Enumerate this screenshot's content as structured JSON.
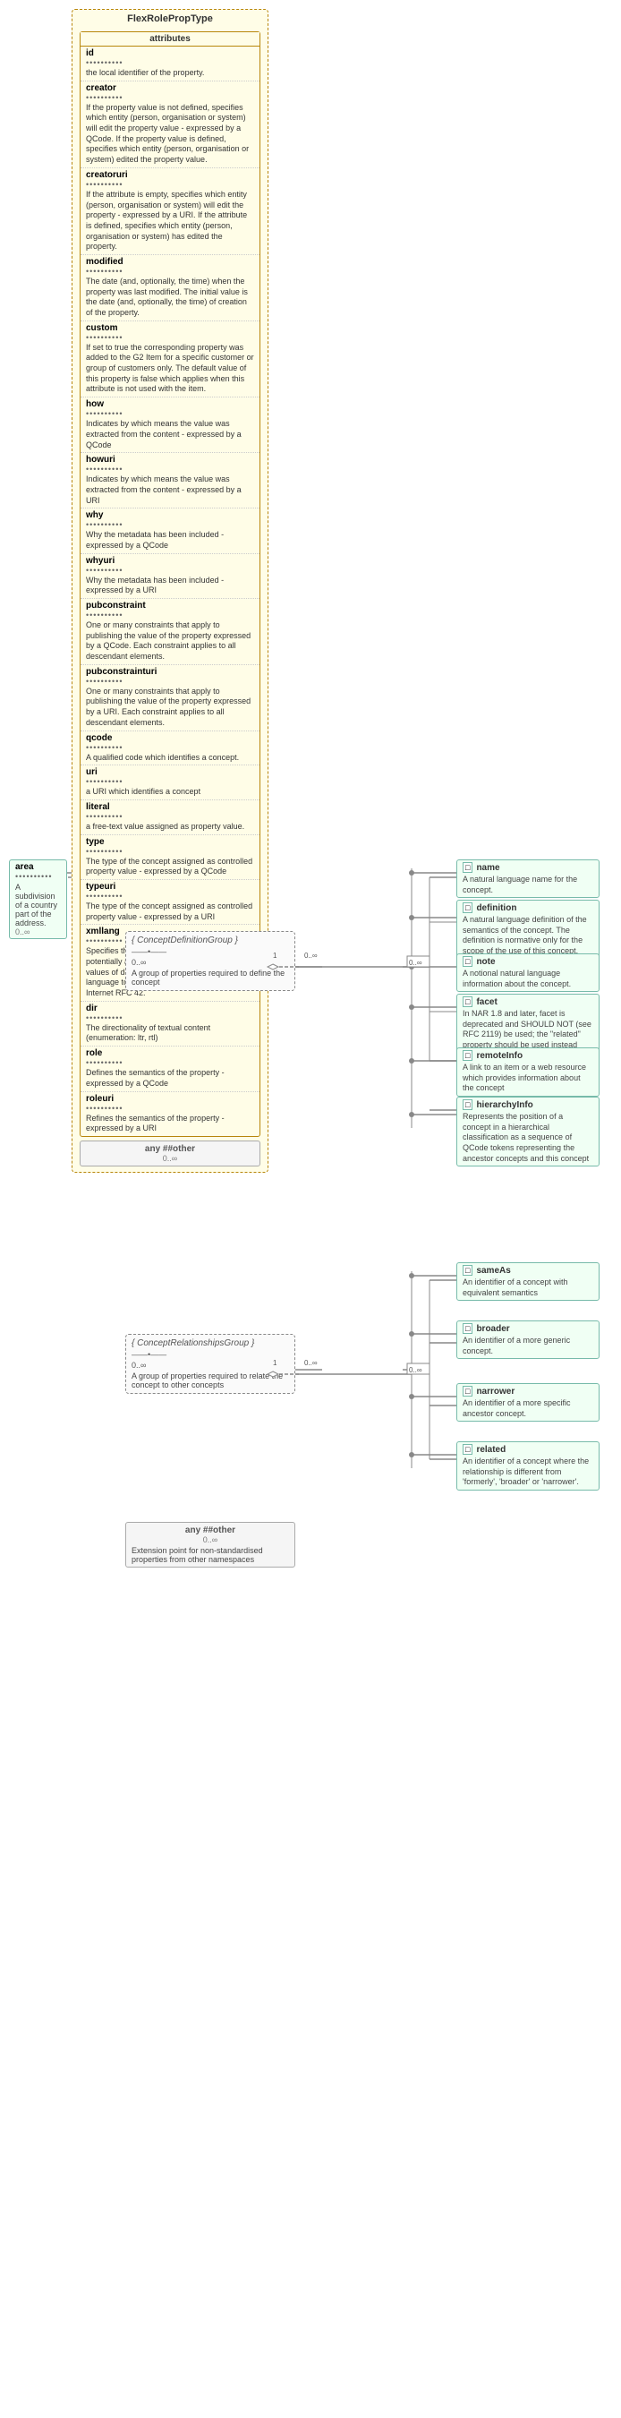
{
  "title": "FlexRolePropType",
  "attributes": {
    "label": "attributes",
    "items": [
      {
        "name": "id",
        "dots": "••••••••••",
        "desc": "the local identifier of the property."
      },
      {
        "name": "creator",
        "uri": true,
        "dots": "••••••••••",
        "desc": "If the property value is not defined, specifies which entity (person, organisation or system) will edit the property value - expressed by a QCode. If the property value is defined, specifies which entity (person, organisation or system) edited the property value."
      },
      {
        "name": "creatoruri",
        "uri": true,
        "dots": "••••••••••",
        "desc": "If the attribute is empty, specifies which entity (person, organisation or system) will edit the property - expressed by a URI. If the attribute is defined, specifies which entity (person, organisation or system) has edited the property."
      },
      {
        "name": "modified",
        "dots": "••••••••••",
        "desc": "The date (and, optionally, the time) when the property was last modified. The initial value is the date (and, optionally, the time) of creation of the property."
      },
      {
        "name": "custom",
        "dots": "••••••••••",
        "desc": "If set to true the corresponding property was added to the G2 Item for a specific customer or group of customers only. The default value of this property is false which applies when this attribute is not used with the item."
      },
      {
        "name": "how",
        "dots": "••••••••••",
        "desc": "Indicates by which means the value was extracted from the content - expressed by a QCode"
      },
      {
        "name": "howuri",
        "uri": true,
        "dots": "••••••••••",
        "desc": "Indicates by which means the value was extracted from the content - expressed by a URI"
      },
      {
        "name": "why",
        "dots": "••••••••••",
        "desc": "Why the metadata has been included - expressed by a QCode"
      },
      {
        "name": "whyuri",
        "uri": true,
        "dots": "••••••••••",
        "desc": "Why the metadata has been included - expressed by a URI"
      },
      {
        "name": "pubconstraint",
        "dots": "••••••••••",
        "desc": "One or many constraints that apply to publishing the value of the property expressed by a QCode. Each constraint applies to all descendant elements."
      },
      {
        "name": "pubconstrainturi",
        "uri": true,
        "dots": "••••••••••",
        "desc": "One or many constraints that apply to publishing the value of the property expressed by a URI. Each constraint applies to all descendant elements."
      },
      {
        "name": "qcode",
        "dots": "••••••••••",
        "desc": "A qualified code which identifies a concept."
      },
      {
        "name": "uri",
        "dots": "••••••••••",
        "desc": "a URI which identifies a concept"
      },
      {
        "name": "literal",
        "dots": "••••••••••",
        "desc": "a free-text value assigned as property value."
      },
      {
        "name": "type",
        "dots": "••••••••••",
        "desc": "The type of the concept assigned as controlled property value - expressed by a QCode"
      },
      {
        "name": "typeuri",
        "uri": true,
        "dots": "••••••••••",
        "desc": "The type of the concept assigned as controlled property value - expressed by a URI"
      },
      {
        "name": "xmllang",
        "dots": "••••••••••",
        "desc": "Specifies the language of this property and potentially all descendant properties. Identifies values of descendant properties expressed as language tokens. Values are determined by Internet RFC 42."
      },
      {
        "name": "dir",
        "dots": "••••••••••",
        "desc": "The directionality of textual content (enumeration: ltr, rtl)"
      },
      {
        "name": "role",
        "dots": "••••••••••",
        "desc": "Defines the semantics of the property - expressed by a QCode"
      },
      {
        "name": "roleuri",
        "uri": true,
        "dots": "••••••••••",
        "desc": "Refines the semantics of the property - expressed by a URI"
      }
    ]
  },
  "any_other": {
    "label": "any ##other",
    "sub1": "0..∞"
  },
  "area_box": {
    "name": "area",
    "dots": "••••••••••",
    "desc": "A subdivision of a country part of the address.",
    "multiplicity": "0..∞"
  },
  "concept_def_group": {
    "title": "{ ConceptDefinitionGroup }",
    "desc": "A group of properties required to define the concept",
    "multiplicity": "——•——",
    "range": "0..∞",
    "items": [
      {
        "name": "name",
        "badge": "□",
        "desc": "A natural language name for the concept."
      },
      {
        "name": "definition",
        "badge": "□",
        "desc": "A natural language definition of the semantics of the concept. The definition is normative only for the scope of the use of this concept."
      },
      {
        "name": "note",
        "badge": "□",
        "desc": "A notional natural language information about the concept."
      },
      {
        "name": "facet",
        "badge": "□",
        "desc": "In NAR 1.8 and later, facet is deprecated and SHOULD NOT (see RFC 2119) be used; the \"related\" property should be used instead (was: An intrinsic property of the concept.)"
      },
      {
        "name": "remoteInfo",
        "badge": "□",
        "desc": "A link to an item or a web resource which provides information about the concept"
      },
      {
        "name": "hierarchyInfo",
        "badge": "□",
        "desc": "Represents the position of a concept in a hierarchical classification as a sequence of QCode tokens representing the ancestor concepts and this concept"
      }
    ]
  },
  "concept_rel_group": {
    "title": "{ ConceptRelationshipsGroup }",
    "desc": "A group of properties required to relate the concept to other concepts",
    "multiplicity": "——•——",
    "range": "0..∞",
    "items": [
      {
        "name": "sameAs",
        "badge": "□",
        "desc": "An identifier of a concept with equivalent semantics"
      },
      {
        "name": "broader",
        "badge": "□",
        "desc": "An identifier of a more generic concept."
      },
      {
        "name": "narrower",
        "badge": "□",
        "desc": "An identifier of a more specific ancestor concept."
      },
      {
        "name": "related",
        "badge": "□",
        "desc": "An identifier of a concept where the relationship is different from 'formerly', 'broader' or 'narrower'."
      }
    ]
  },
  "any_other_bottom": {
    "label": "any ##other",
    "sub1": "0..∞",
    "desc": "Extension point for non-standardised properties from other namespaces"
  },
  "colors": {
    "border_main": "#b8860b",
    "border_group": "#aaa",
    "border_right": "#7ba",
    "bg_main": "#fffde7",
    "bg_right": "#f0fff4"
  }
}
